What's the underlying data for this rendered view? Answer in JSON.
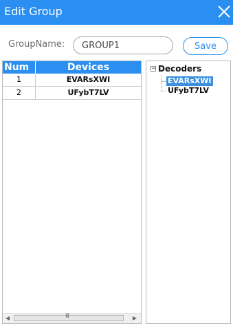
{
  "window": {
    "title": "Edit Group"
  },
  "form": {
    "label": "GroupName:",
    "value": "GROUP1",
    "save_label": "Save"
  },
  "grid": {
    "columns": [
      "Num",
      "Devices"
    ],
    "rows": [
      {
        "num": "1",
        "device": "EVARsXWI"
      },
      {
        "num": "2",
        "device": "UFybT7LV"
      }
    ]
  },
  "scrollbar": {
    "grip": "III"
  },
  "tree": {
    "root": "Decoders",
    "children": [
      "EVARsXWI",
      "UFybT7LV"
    ],
    "selected_index": 0
  },
  "colors": {
    "accent": "#2a8ff0",
    "selection": "#3a8fde"
  }
}
